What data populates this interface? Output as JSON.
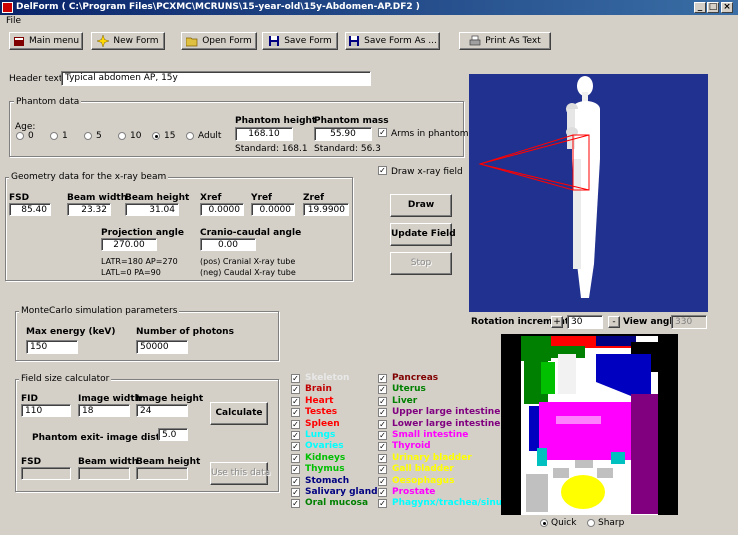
{
  "window": {
    "title": "DelForm  ( C:\\Program Files\\PCXMC\\MCRUNS\\15-year-old\\15y-Abdomen-AP.DF2 )",
    "controls": [
      "_",
      "□",
      "×"
    ]
  },
  "menu": {
    "file": "File"
  },
  "toolbar": {
    "main_menu": "Main menu",
    "new_form": "New Form",
    "open_form": "Open Form",
    "save_form": "Save Form",
    "save_form_as": "Save Form As ...",
    "print_as_text": "Print As Text"
  },
  "header": {
    "label": "Header text",
    "value": "Typical abdomen AP, 15y"
  },
  "phantom": {
    "group_title": "Phantom data",
    "age_label": "Age:",
    "ages": [
      "0",
      "1",
      "5",
      "10",
      "15",
      "Adult"
    ],
    "selected_age": "15",
    "height_label": "Phantom height",
    "height_value": "168.10",
    "height_standard": "Standard: 168.1",
    "mass_label": "Phantom mass",
    "mass_value": "55.90",
    "mass_standard": "Standard: 56.3",
    "arms_label": "Arms in phantom",
    "arms_checked": true
  },
  "geometry": {
    "group_title": "Geometry data for the x-ray beam",
    "fsd_label": "FSD",
    "fsd_value": "85.40",
    "beam_width_label": "Beam width",
    "beam_width_value": "23.32",
    "beam_height_label": "Beam height",
    "beam_height_value": "31.04",
    "xref_label": "Xref",
    "xref_value": "0.0000",
    "yref_label": "Yref",
    "yref_value": "0.0000",
    "zref_label": "Zref",
    "zref_value": "19.9900",
    "projection_label": "Projection angle",
    "projection_value": "270.00",
    "cranio_label": "Cranio-caudal angle",
    "cranio_value": "0.00",
    "note1": "LATR=180  AP=270",
    "note2": "LATL=0     PA=90",
    "note3": "(pos) Cranial X-ray tube",
    "note4": "(neg) Caudal X-ray tube"
  },
  "draw_xray_field": {
    "label": "Draw x-ray field",
    "checked": true
  },
  "buttons": {
    "draw": "Draw",
    "update_field": "Update Field",
    "stop": "Stop"
  },
  "montecarlo": {
    "group_title": "MonteCarlo simulation parameters",
    "max_energy_label": "Max energy (keV)",
    "max_energy_value": "150",
    "photons_label": "Number of photons",
    "photons_value": "50000"
  },
  "fieldsize": {
    "group_title": "Field size calculator",
    "fid_label": "FID",
    "fid_value": "110",
    "image_width_label": "Image width",
    "image_width_value": "18",
    "image_height_label": "Image height",
    "image_height_value": "24",
    "calculate": "Calculate",
    "exit_label": "Phantom exit- image distance:",
    "exit_value": "5.0",
    "fsd_label": "FSD",
    "beam_width_label": "Beam width",
    "beam_height_label": "Beam height",
    "use_data": "Use this data"
  },
  "organs_left": [
    {
      "name": "Skeleton",
      "color": "#e8e8e8"
    },
    {
      "name": "Brain",
      "color": "#c00000"
    },
    {
      "name": "Heart",
      "color": "#ff0000"
    },
    {
      "name": "Testes",
      "color": "#ff0000"
    },
    {
      "name": "Spleen",
      "color": "#ff0000"
    },
    {
      "name": "Lungs",
      "color": "#00ffff"
    },
    {
      "name": "Ovaries",
      "color": "#00ffff"
    },
    {
      "name": "Kidneys",
      "color": "#00c000"
    },
    {
      "name": "Thymus",
      "color": "#00c000"
    },
    {
      "name": "Stomach",
      "color": "#000080"
    },
    {
      "name": "Salivary glands",
      "color": "#000080"
    },
    {
      "name": "Oral mucosa",
      "color": "#008000"
    }
  ],
  "organs_right": [
    {
      "name": "Pancreas",
      "color": "#800000"
    },
    {
      "name": "Uterus",
      "color": "#008000"
    },
    {
      "name": "Liver",
      "color": "#008000"
    },
    {
      "name": "Upper large intestine",
      "color": "#800080"
    },
    {
      "name": "Lower large intestine",
      "color": "#800080"
    },
    {
      "name": "Small intestine",
      "color": "#ff00ff"
    },
    {
      "name": "Thyroid",
      "color": "#ff00ff"
    },
    {
      "name": "Urinary bladder",
      "color": "#ffff00"
    },
    {
      "name": "Gall bladder",
      "color": "#ffff00"
    },
    {
      "name": "Oesophagus",
      "color": "#ffff00"
    },
    {
      "name": "Prostate",
      "color": "#ff00ff"
    },
    {
      "name": "Phagynx/trachea/sinus",
      "color": "#00ffff"
    }
  ],
  "view3d": {
    "background": "#21318f",
    "phantom_color": "#ffffff",
    "beam_color": "#ff0000"
  },
  "rotation": {
    "label": "Rotation increment",
    "plus": "+",
    "minus": "-",
    "value": "30",
    "view_label": "View angle",
    "view_value": "330"
  },
  "render": {
    "quick": "Quick",
    "sharp": "Sharp",
    "selected": "Quick"
  }
}
